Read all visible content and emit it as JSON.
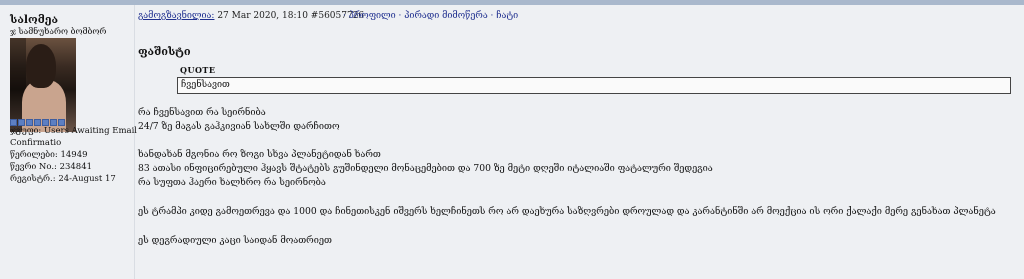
{
  "author": {
    "username": "საlომეა",
    "title": "ჯ სამნუხარო ბომბორ",
    "stats": [
      "ჯგუფი: Users Awaiting Email",
      "Confirmatio",
      "წერილები: 14949",
      "წევრი No.: 234841",
      "რეგისტრ.: 24-August 17"
    ]
  },
  "post": {
    "link_label": "გამოგზავნილია:",
    "date": " 27 Mar 2020, 18:10  #56057726",
    "links": "· პროფილი · პირადი მიმოწერა · ჩატი",
    "title": "ფაშისტი",
    "quote_label": "QUOTE",
    "quote_text": "ჩვენსავით",
    "body": [
      "რა ჩვენსავით რა სეირნიბა",
      "24/7 ზე მაგას გაჰკივიან სახლში დარჩითო",
      "ხანდახან მგონია რო ზოგი სხვა პლანეტიდან ხართ",
      "83 ათასი ინფიცირებული ჰყავს შტატებს გუშინდელი მონაცემებით და 700 ზე მეტი დღეში იტალიაში ფატალური შედეგია",
      "რა სუფთა ჰაერი ხალხრო რა სეირნობა",
      "ეს ტრამპი კიდე გამოეთრევა და 1000 და ჩინეთისკენ იშვერს ხელჩინეთს რო არ დაეხურა საზღვრები დროულად და კარანტინში არ მოექცია ის ორი ქალაქი მერე გენახათ პლანეტა",
      "ეს დეგრადიული კაცი საიდან მოათრიეთ"
    ]
  }
}
